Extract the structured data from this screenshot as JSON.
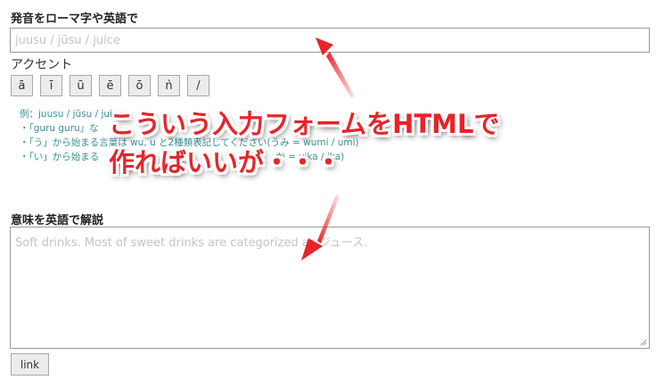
{
  "pronunciation": {
    "label": "発音をローマ字や英語で",
    "placeholder": "juusu / jūsu / juice"
  },
  "accent": {
    "label": "アクセント",
    "buttons": [
      "ā",
      "ī",
      "ū",
      "ē",
      "ō",
      "ǹ",
      "/"
    ]
  },
  "hints": {
    "example": "例：juusu / jūsu / juice",
    "line1": "・「guru guru」な",
    "line2": "・「う」から始まる言葉は wu, u と2種類表記してください(うみ = wumi / umi)",
    "line3": "・「い」から始まる",
    "line3_tail": "か = yika / ika)"
  },
  "meaning": {
    "label": "意味を英語で解説",
    "placeholder": "Soft drinks. Most of sweet drinks are categorized as ジュース."
  },
  "link_button": "link",
  "annotation": {
    "line1": "こういう入力フォームをHTMLで",
    "line2": "作ればいいが・・・"
  },
  "colors": {
    "annotation": "#e8232a",
    "hint_text": "#3a8f96"
  }
}
